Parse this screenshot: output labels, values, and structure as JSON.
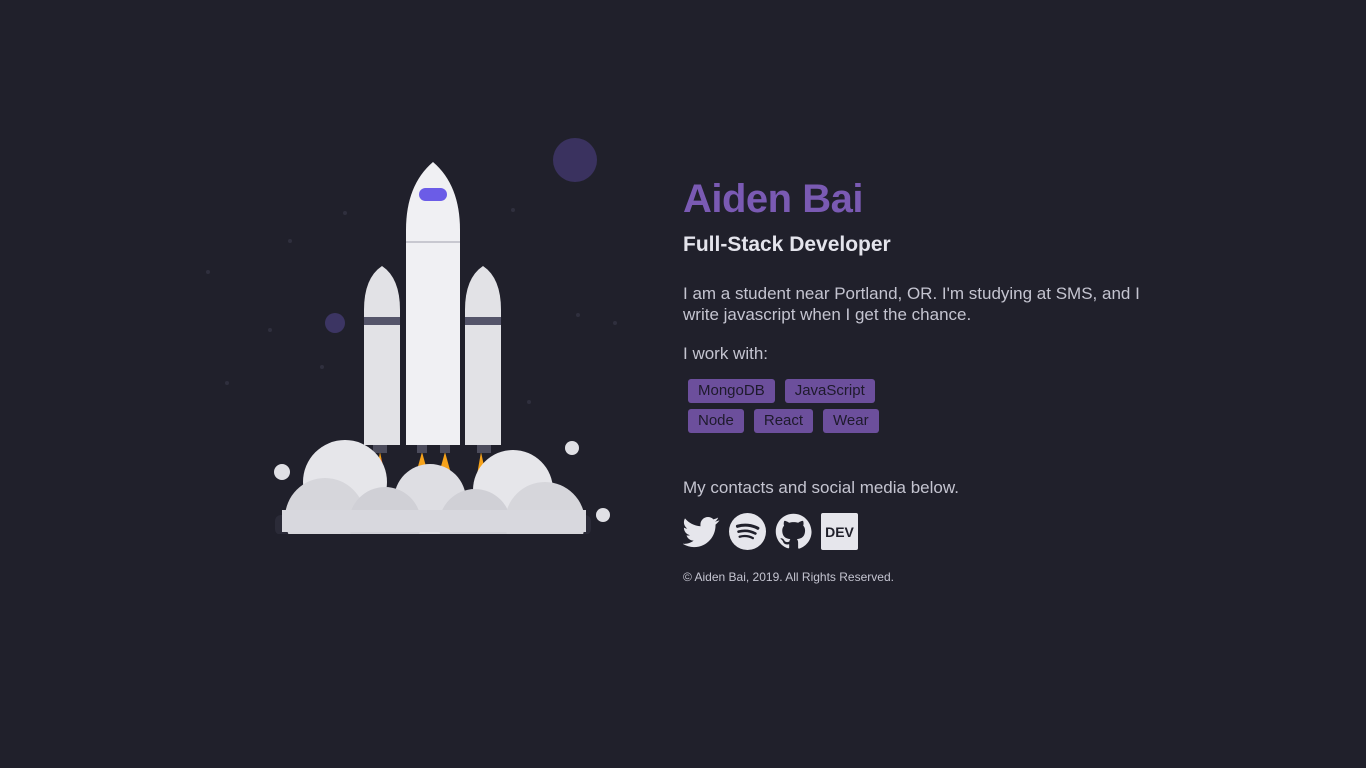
{
  "profile": {
    "name": "Aiden Bai",
    "role": "Full-Stack Developer",
    "bio": "I am a student near Portland, OR. I'm studying at SMS, and I write javascript when I get the chance.",
    "work_with_label": "I work with:"
  },
  "tags": [
    "MongoDB",
    "JavaScript",
    "Node",
    "React",
    "Wear"
  ],
  "contacts": {
    "label": "My contacts and social media below.",
    "icons": [
      "twitter-icon",
      "spotify-icon",
      "github-icon",
      "dev-icon"
    ],
    "dev_label": "DEV"
  },
  "footer": {
    "copyright": "© Aiden Bai, 2019. All Rights Reserved."
  },
  "colors": {
    "background": "#20202b",
    "accent": "#7a5ab3",
    "tag_background": "#6c4f9c",
    "text": "#c4c4d0"
  }
}
